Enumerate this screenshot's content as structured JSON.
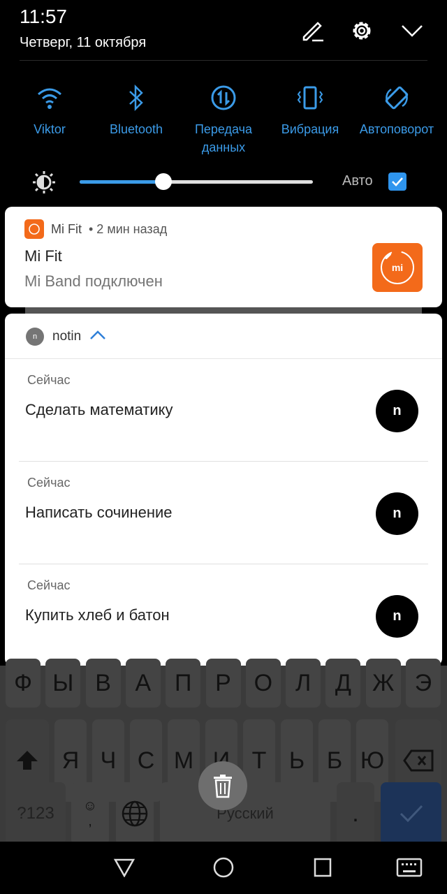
{
  "status": {
    "time": "11:57",
    "date": "Четверг, 11 октября"
  },
  "header_icons": [
    "edit-icon",
    "settings-icon",
    "collapse-icon"
  ],
  "quick_settings": [
    {
      "label": "Viktor",
      "icon": "wifi-icon"
    },
    {
      "label": "Bluetooth",
      "icon": "bluetooth-icon"
    },
    {
      "label": "Передача данных",
      "icon": "mobile-data-icon"
    },
    {
      "label": "Вибрация",
      "icon": "vibrate-icon"
    },
    {
      "label": "Автоповорот",
      "icon": "auto-rotate-icon"
    }
  ],
  "brightness": {
    "level_percent": 36,
    "auto_label": "Авто",
    "auto_checked": true
  },
  "mifit": {
    "app": "Mi Fit",
    "time": "• 2 мин назад",
    "title": "Mi Fit",
    "text": "Mi Band подключен",
    "icon_text": "mi",
    "color": "#f36a1a"
  },
  "notin": {
    "app": "notin",
    "avatar": "n",
    "items": [
      {
        "when": "Сейчас",
        "text": "Сделать математику",
        "badge": "n"
      },
      {
        "when": "Сейчас",
        "text": "Написать сочинение",
        "badge": "n"
      },
      {
        "when": "Сейчас",
        "text": "Купить хлеб и батон",
        "badge": "n"
      }
    ]
  },
  "keyboard": {
    "row1": [
      "Ф",
      "Ы",
      "В",
      "А",
      "П",
      "Р",
      "О",
      "Л",
      "Д",
      "Ж",
      "Э"
    ],
    "row2": [
      "Я",
      "Ч",
      "С",
      "М",
      "И",
      "Т",
      "Ь",
      "Б",
      "Ю"
    ],
    "sym": "?123",
    "comma": ",",
    "space": "Русский",
    "period": "."
  }
}
